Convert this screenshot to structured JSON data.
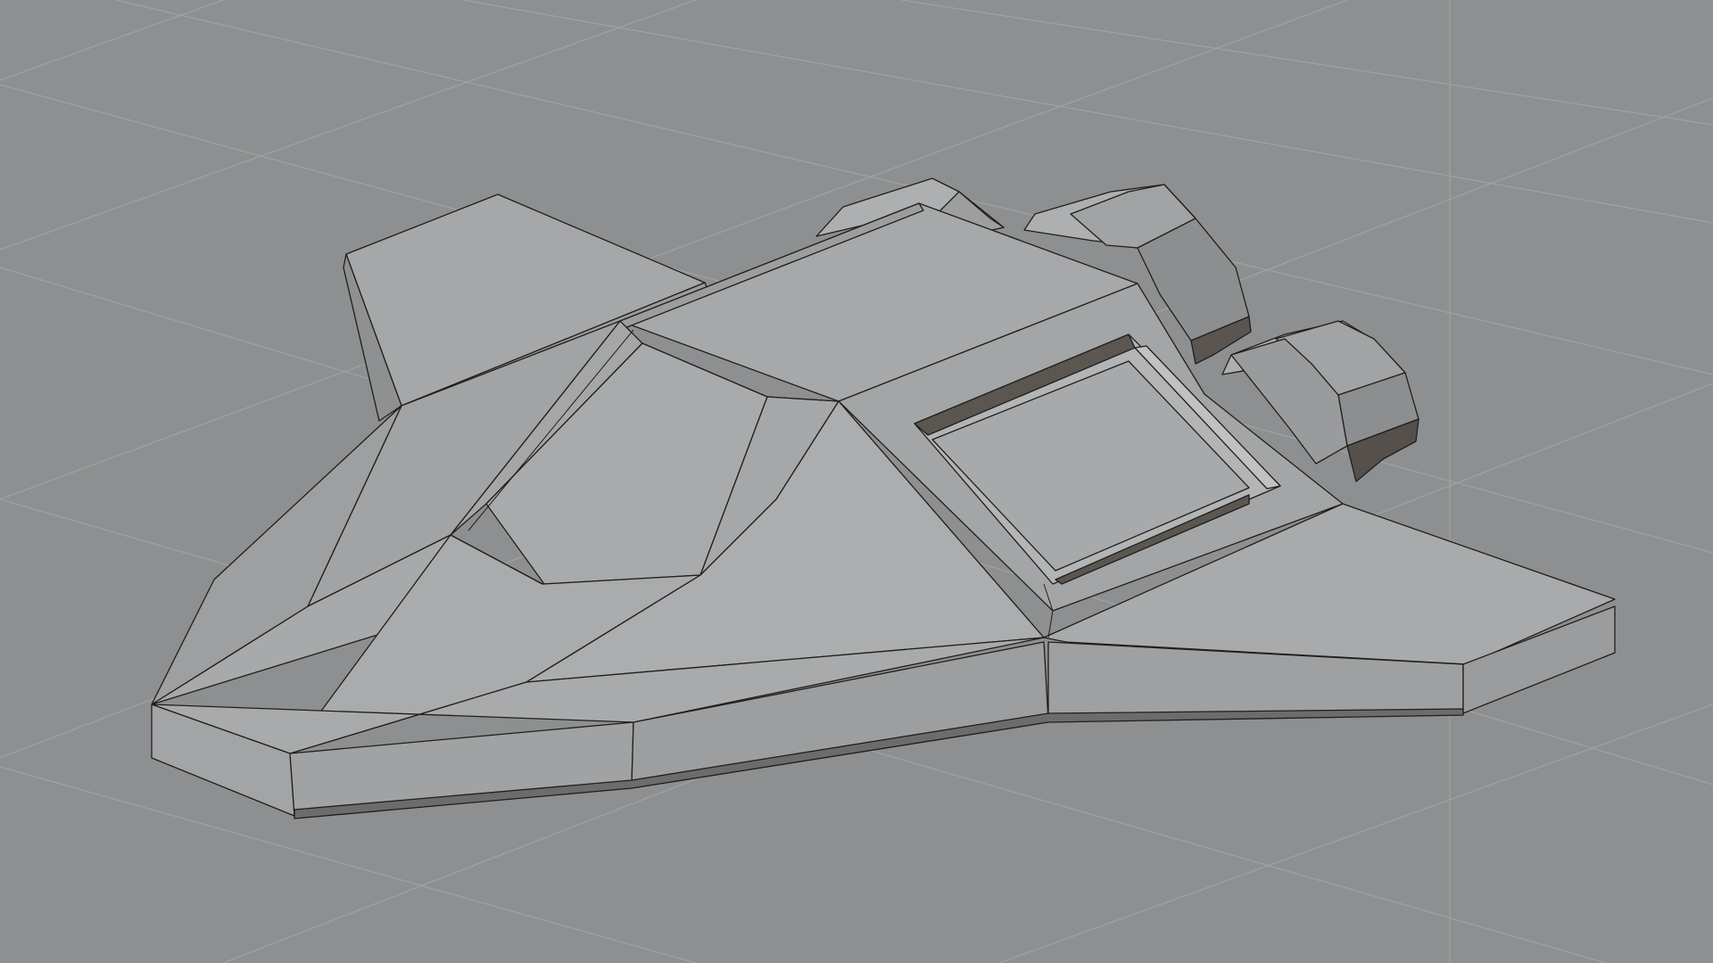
{
  "viewport": {
    "background_color": "#8e8f90",
    "grid_color": "#a1a2a3",
    "grid_visible": true,
    "shading_mode": "solid-flat"
  },
  "model": {
    "colors": {
      "light": "#aeafb0",
      "mid": "#a0a1a2",
      "side": "#9a9b9c",
      "dark": "#858687",
      "shadow": "#55504b",
      "edge": "#1e1e1e"
    }
  }
}
